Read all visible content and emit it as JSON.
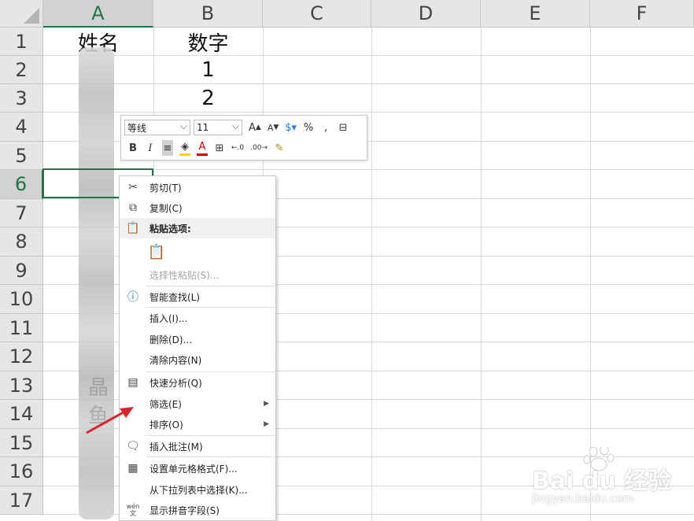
{
  "columns": [
    "A",
    "B",
    "C",
    "D",
    "E",
    "F"
  ],
  "rows": [
    "1",
    "2",
    "3",
    "4",
    "5",
    "6",
    "7",
    "8",
    "9",
    "10",
    "11",
    "12",
    "13",
    "14",
    "15",
    "16",
    "17"
  ],
  "cells": {
    "A1": "姓名",
    "B1": "数字",
    "B2": "1",
    "B3": "2",
    "A13": "晶",
    "A14": "鱼"
  },
  "mini_toolbar": {
    "font_name": "等线",
    "font_size": "11",
    "grow_font": "A",
    "shrink_font": "A",
    "percent": "%",
    "comma": ",",
    "bold": "B",
    "italic": "I",
    "font_color": "A"
  },
  "context_menu": {
    "items": [
      {
        "label": "剪切(T)",
        "icon": "scissors-icon"
      },
      {
        "label": "复制(C)",
        "icon": "copy-icon"
      },
      {
        "label": "粘贴选项:",
        "icon": "paste-icon"
      },
      {
        "label": "",
        "icon": "paste-option-icon"
      },
      {
        "label": "选择性粘贴(S)...",
        "icon": ""
      },
      {
        "label": "智能查找(L)",
        "icon": "smart-lookup-icon"
      },
      {
        "label": "插入(I)...",
        "icon": ""
      },
      {
        "label": "删除(D)...",
        "icon": ""
      },
      {
        "label": "清除内容(N)",
        "icon": ""
      },
      {
        "label": "快速分析(Q)",
        "icon": "quick-analysis-icon"
      },
      {
        "label": "筛选(E)",
        "icon": ""
      },
      {
        "label": "排序(O)",
        "icon": ""
      },
      {
        "label": "插入批注(M)",
        "icon": "comment-icon"
      },
      {
        "label": "设置单元格格式(F)...",
        "icon": "format-cells-icon"
      },
      {
        "label": "从下拉列表中选择(K)...",
        "icon": ""
      },
      {
        "label": "显示拼音字段(S)",
        "icon": "phonetic-icon"
      }
    ],
    "phonetic_icon_text": "wén"
  },
  "watermark": {
    "brand": "Bai du 经验",
    "url": "jingyan.baidu.com"
  },
  "colors": {
    "accent": "#217346",
    "arrow": "#d9262c"
  }
}
